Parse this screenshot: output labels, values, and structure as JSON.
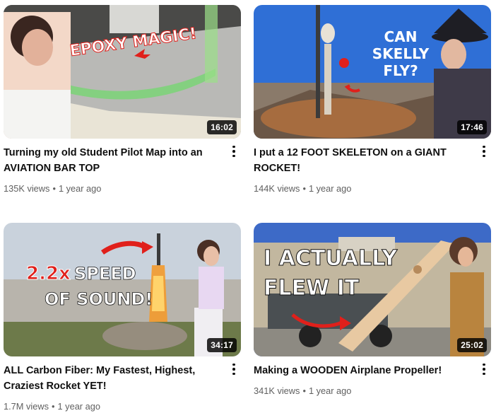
{
  "videos": [
    {
      "title": "Turning my old Student Pilot Map into an AVIATION BAR TOP",
      "views": "135K views",
      "age": "1 year ago",
      "duration": "16:02",
      "overlay": [
        "EPOXY MAGIC!"
      ],
      "icon": "more-vert-icon"
    },
    {
      "title": "I put a 12 FOOT SKELETON on a GIANT ROCKET!",
      "views": "144K views",
      "age": "1 year ago",
      "duration": "17:46",
      "overlay": [
        "CAN",
        "SKELLY",
        "FLY?"
      ],
      "icon": "more-vert-icon"
    },
    {
      "title": "ALL Carbon Fiber: My Fastest, Highest, Craziest Rocket YET!",
      "views": "1.7M views",
      "age": "1 year ago",
      "duration": "34:17",
      "overlay": [
        "2.2x",
        "SPEED",
        "OF SOUND!"
      ],
      "icon": "more-vert-icon"
    },
    {
      "title": "Making a WOODEN Airplane Propeller!",
      "views": "341K views",
      "age": "1 year ago",
      "duration": "25:02",
      "overlay": [
        "I ACTUALLY",
        "FLEW IT"
      ],
      "icon": "more-vert-icon"
    }
  ],
  "separator": "•",
  "colors": {
    "title": "#0f0f0f",
    "secondary": "#606060",
    "duration_bg": "#000000",
    "arrow_red": "#e0201b"
  }
}
